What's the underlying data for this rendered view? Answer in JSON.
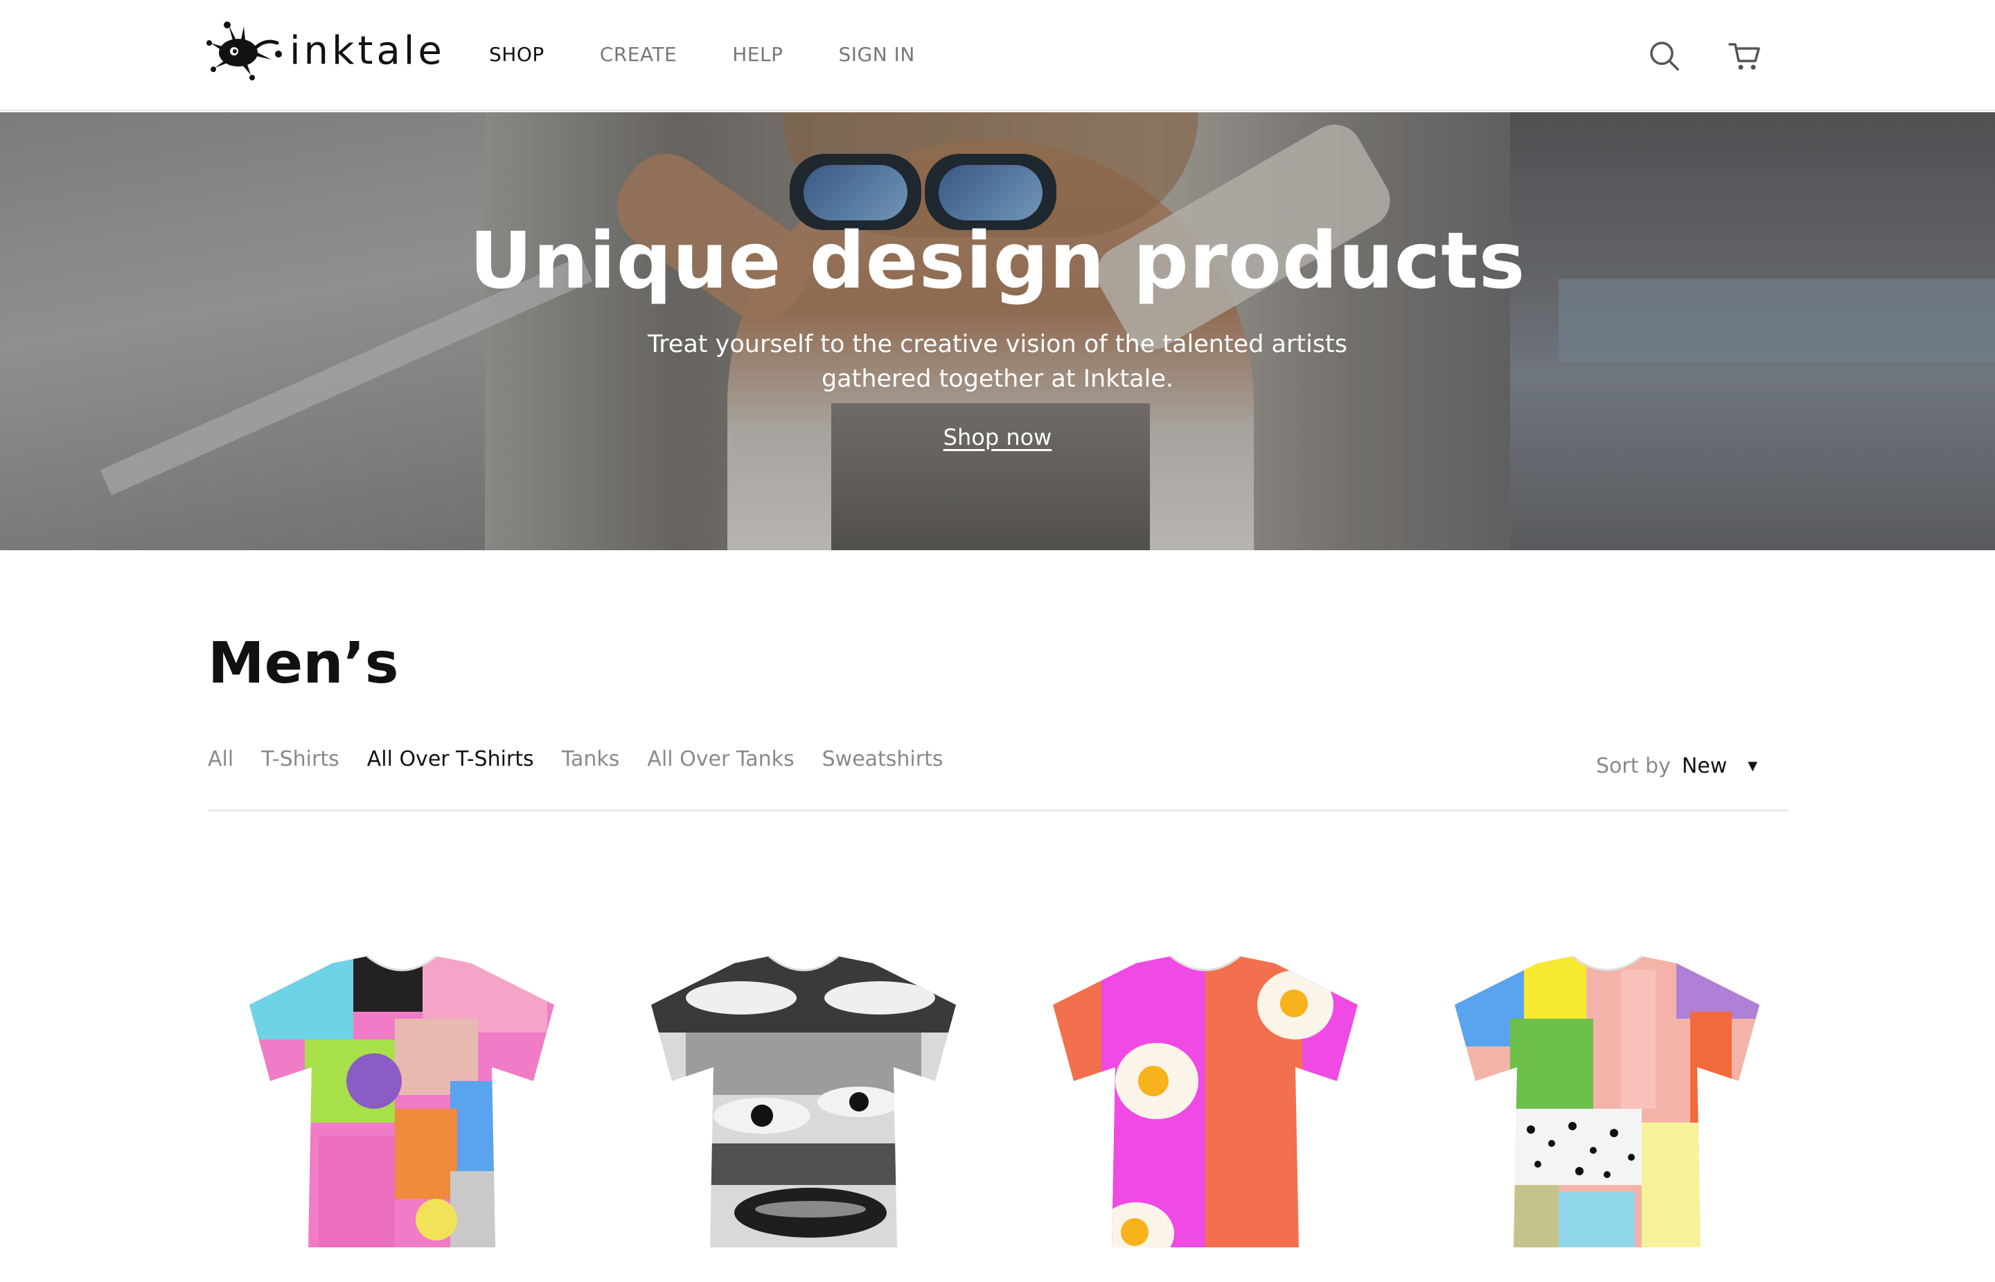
{
  "brand": {
    "name": "inktale"
  },
  "nav": {
    "items": [
      {
        "label": "SHOP",
        "active": true
      },
      {
        "label": "CREATE",
        "active": false
      },
      {
        "label": "HELP",
        "active": false
      },
      {
        "label": "SIGN IN",
        "active": false
      }
    ]
  },
  "header_icons": [
    "search-icon",
    "cart-icon"
  ],
  "hero": {
    "title": "Unique design products",
    "subtitle": "Treat yourself to the creative vision of the talented artists gathered together at Inktale.",
    "cta": "Shop now"
  },
  "catalog": {
    "title": "Men’s",
    "filters": [
      {
        "label": "All",
        "active": false
      },
      {
        "label": "T-Shirts",
        "active": false
      },
      {
        "label": "All Over T-Shirts",
        "active": true
      },
      {
        "label": "Tanks",
        "active": false
      },
      {
        "label": "All Over Tanks",
        "active": false
      },
      {
        "label": "Sweatshirts",
        "active": false
      }
    ],
    "sort": {
      "label": "Sort by",
      "value": "New"
    },
    "products": [
      {
        "design": "colorful collage all over t-shirt"
      },
      {
        "design": "black and white faces collage all over t-shirt"
      },
      {
        "design": "fried eggs on pink and orange all over t-shirt"
      },
      {
        "design": "pastel color blocks all over t-shirt"
      }
    ]
  },
  "colors": {
    "text_primary": "#111111",
    "text_muted": "#8a8a8a",
    "divider": "#ececec",
    "hero_text": "#ffffff"
  }
}
